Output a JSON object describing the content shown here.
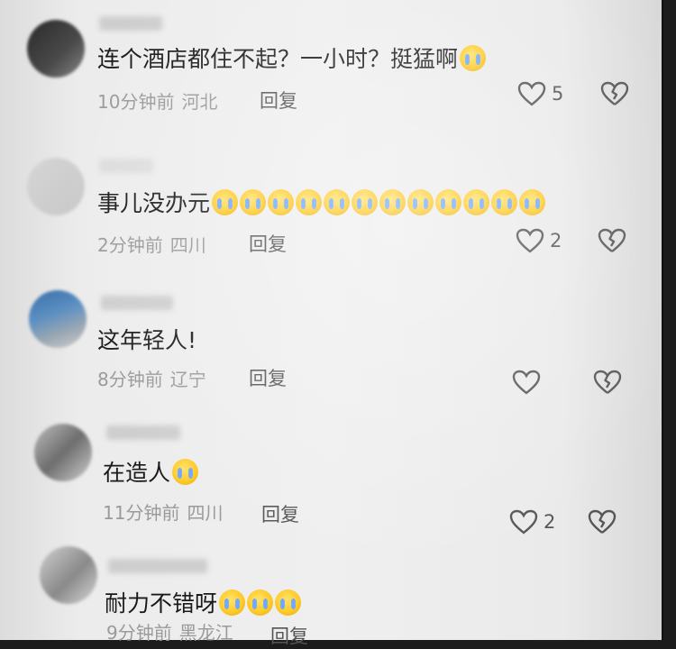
{
  "comments": [
    {
      "text": "连个酒店都住不起？一小时？挺猛啊",
      "emoji_count": 1,
      "time": "10分钟前",
      "location": "河北",
      "reply": "回复",
      "likes": "5"
    },
    {
      "text": "事儿没办元",
      "emoji_count": 12,
      "time": "2分钟前",
      "location": "四川",
      "reply": "回复",
      "likes": "2"
    },
    {
      "text": "这年轻人!",
      "emoji_count": 0,
      "time": "8分钟前",
      "location": "辽宁",
      "reply": "回复",
      "likes": ""
    },
    {
      "text": "在造人",
      "emoji_count": 1,
      "time": "11分钟前",
      "location": "四川",
      "reply": "回复",
      "likes": "2"
    },
    {
      "text": "耐力不错呀",
      "emoji_count": 3,
      "time": "9分钟前",
      "location": "黑龙江",
      "reply": "回复",
      "likes": ""
    }
  ],
  "icons": {
    "like": "heart-outline-icon",
    "dislike": "broken-heart-icon",
    "emoji": "crying-laughing-emoji"
  },
  "colors": {
    "text": "#1a1a1a",
    "meta": "#9a9a9a",
    "icon": "#555555",
    "emoji_face": "#ffcb2b",
    "emoji_tear": "#6fa8ff"
  }
}
